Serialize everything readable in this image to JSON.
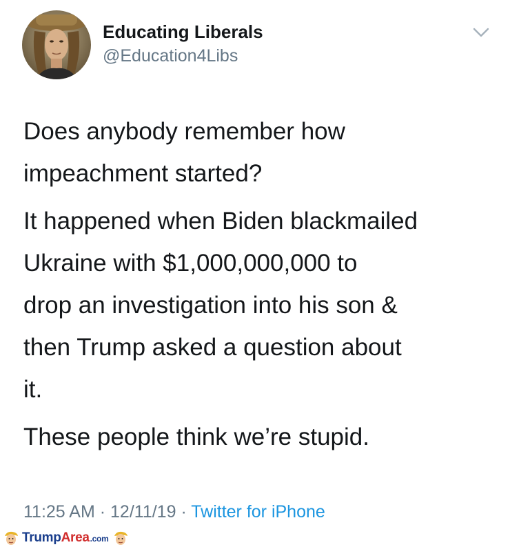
{
  "tweet": {
    "author": {
      "display_name": "Educating Liberals",
      "handle": "@Education4Libs",
      "avatar_icon": "user-avatar-photo"
    },
    "menu_icon": "chevron-down-icon",
    "paragraphs": [
      "Does anybody remember how\nimpeachment started?",
      "It happened when Biden blackmailed\nUkraine with $1,000,000,000 to\ndrop an investigation into his son &\nthen Trump asked a question about\nit.",
      "These people think we’re stupid."
    ],
    "time": "11:25 AM",
    "separator": "·",
    "date": "12/11/19",
    "source": "Twitter for iPhone"
  },
  "watermark": {
    "brand_part1": "Trump",
    "brand_part2": "Area",
    "brand_suffix": ".com",
    "icon": "trump-caricature-icon"
  },
  "colors": {
    "text_primary": "#14171a",
    "text_secondary": "#657786",
    "link": "#1b95e0",
    "watermark_blue": "#1a3e8c",
    "watermark_red": "#d12e2e"
  }
}
